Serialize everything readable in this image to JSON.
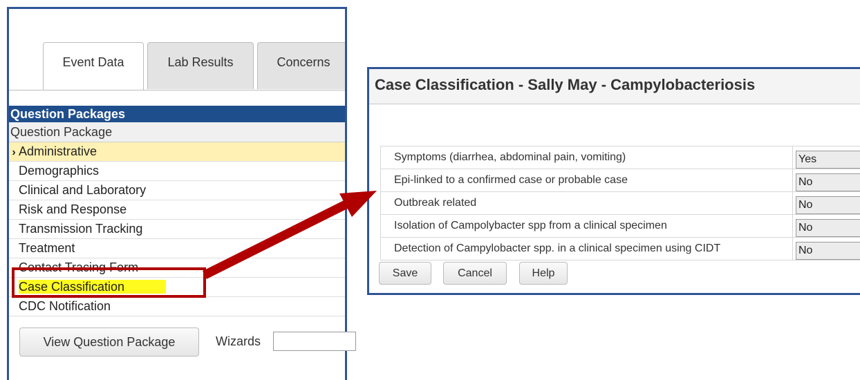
{
  "tabs": [
    "Event Data",
    "Lab Results",
    "Concerns"
  ],
  "question_packages": {
    "header": "Question Packages",
    "column_header": "Question Package",
    "items": [
      "Administrative",
      "Demographics",
      "Clinical and Laboratory",
      "Risk and Response",
      "Transmission Tracking",
      "Treatment",
      "Contact Tracing Form",
      "Case Classification",
      "CDC Notification"
    ]
  },
  "view_button": "View Question Package",
  "wizards_label": "Wizards",
  "dialog": {
    "title": "Case Classification - Sally May - Campylobacteriosis",
    "criteria": [
      {
        "label": "Symptoms (diarrhea, abdominal pain, vomiting)",
        "value": "Yes"
      },
      {
        "label": "Epi-linked to a confirmed case or probable case",
        "value": "No"
      },
      {
        "label": "Outbreak related",
        "value": "No"
      },
      {
        "label": "Isolation of Campolybacter spp from a clinical specimen",
        "value": "No"
      },
      {
        "label": "Detection of Campylobacter spp. in a clinical specimen using CIDT",
        "value": "No"
      }
    ],
    "buttons": {
      "save": "Save",
      "cancel": "Cancel",
      "help": "Help"
    }
  },
  "colors": {
    "panel_border": "#2e5597",
    "header_bg": "#1f4e8c",
    "active_row_bg": "#fff1b3",
    "highlight_yellow": "#fffb1e",
    "callout_red": "#b00000"
  },
  "icons": {
    "active_row": "chevron-right-icon",
    "callout": "arrow-icon"
  }
}
